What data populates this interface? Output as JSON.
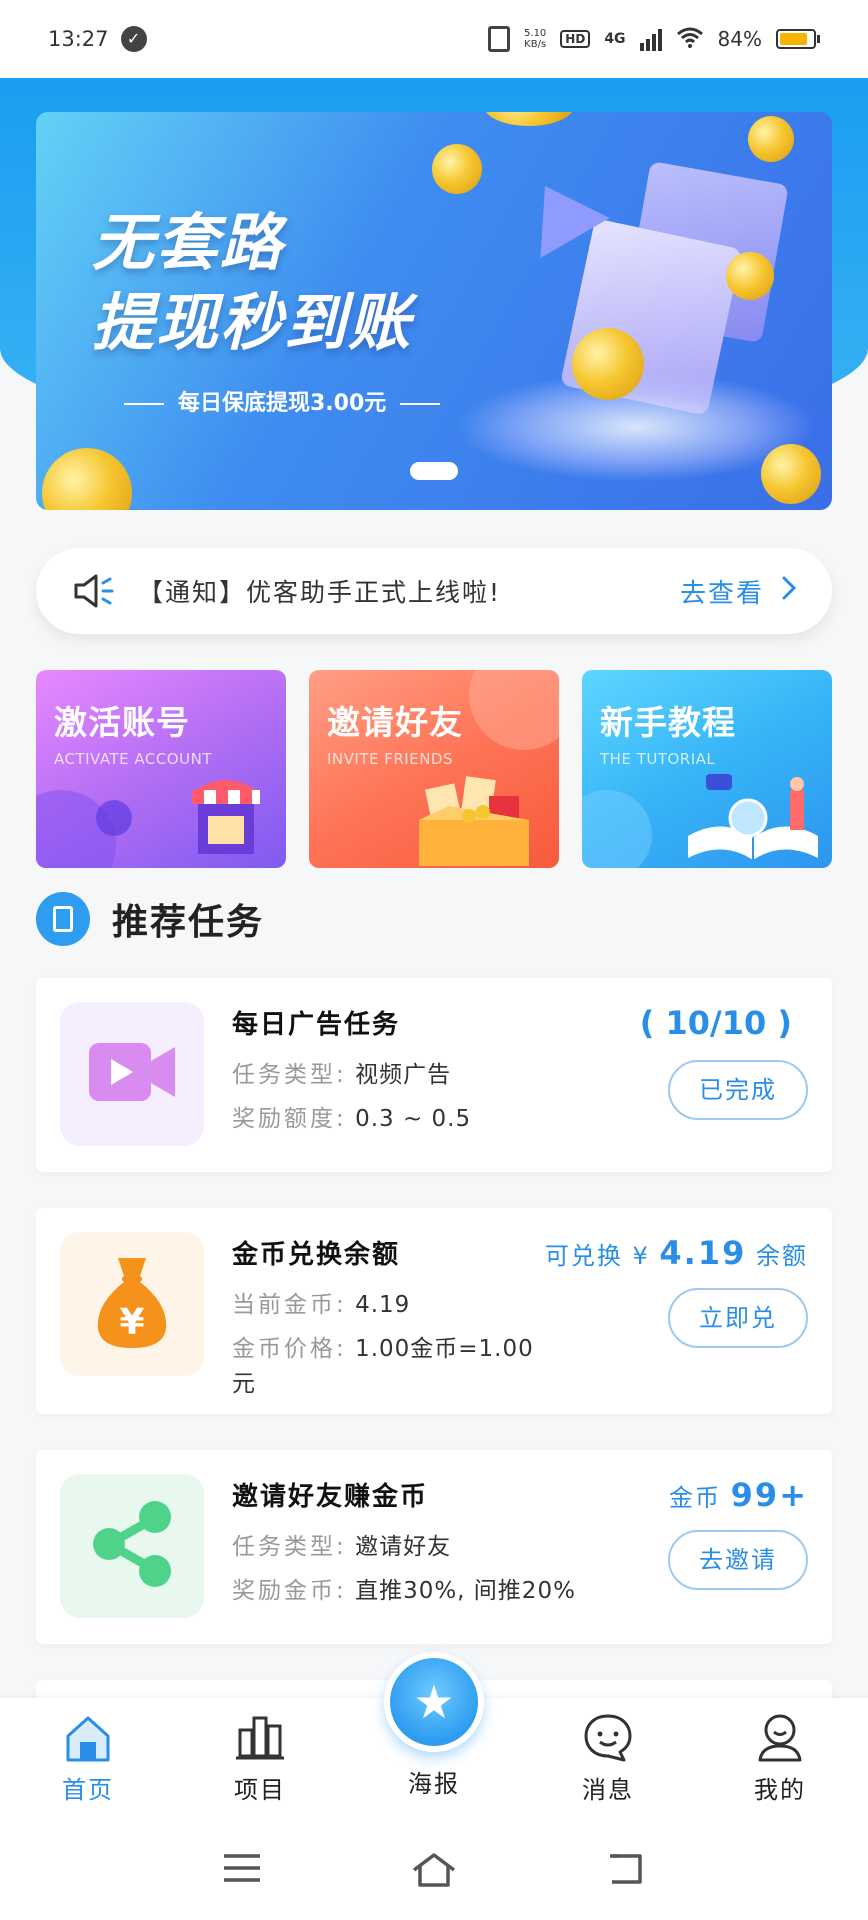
{
  "status_bar": {
    "time": "13:27",
    "net_speed_value": "5.10",
    "net_speed_unit": "KB/s",
    "hd": "HD",
    "network": "4G",
    "battery": "84%",
    "battery_level": 0.84
  },
  "banner": {
    "title_line1": "无套路",
    "title_line2": "提现秒到账",
    "subtitle": "每日保底提现3.00元"
  },
  "notice": {
    "text": "【通知】优客助手正式上线啦!",
    "action": "去查看"
  },
  "quick_cards": [
    {
      "title": "激活账号",
      "subtitle": "ACTIVATE ACCOUNT"
    },
    {
      "title": "邀请好友",
      "subtitle": "INVITE FRIENDS"
    },
    {
      "title": "新手教程",
      "subtitle": "THE TUTORIAL"
    }
  ],
  "section": {
    "title": "推荐任务"
  },
  "tasks": [
    {
      "name": "每日广告任务",
      "row1_key": "任务类型:",
      "row1_val": "视频广告",
      "row2_key": "奖励额度:",
      "row2_val": "0.3 ~ 0.5",
      "progress": "( 10/10 )",
      "button": "已完成",
      "icon": "video-icon",
      "color": "#d98cf0"
    },
    {
      "name": "金币兑换余额",
      "row1_key": "当前金币:",
      "row1_val": "4.19",
      "row2_key": "金币价格:",
      "row2_val": "1.00金币=1.00",
      "row2_wrap": "元",
      "exchange_prefix": "可兑换 ¥",
      "exchange_amount": "4.19",
      "exchange_suffix": "余额",
      "button": "立即兑",
      "icon": "money-bag-icon",
      "color": "#f5921b"
    },
    {
      "name": "邀请好友赚金币",
      "row1_key": "任务类型:",
      "row1_val": "邀请好友",
      "row2_key": "奖励金币:",
      "row2_val": "直推30%, 间推20%",
      "coin_label": "金币",
      "coin_amount": "99+",
      "button": "去邀请",
      "icon": "share-icon",
      "color": "#4fd38a"
    }
  ],
  "tabbar": {
    "home": "首页",
    "projects": "项目",
    "poster": "海报",
    "messages": "消息",
    "mine": "我的"
  },
  "colors": {
    "accent": "#2a8ee8",
    "header_blue": "#1a9ef0"
  }
}
